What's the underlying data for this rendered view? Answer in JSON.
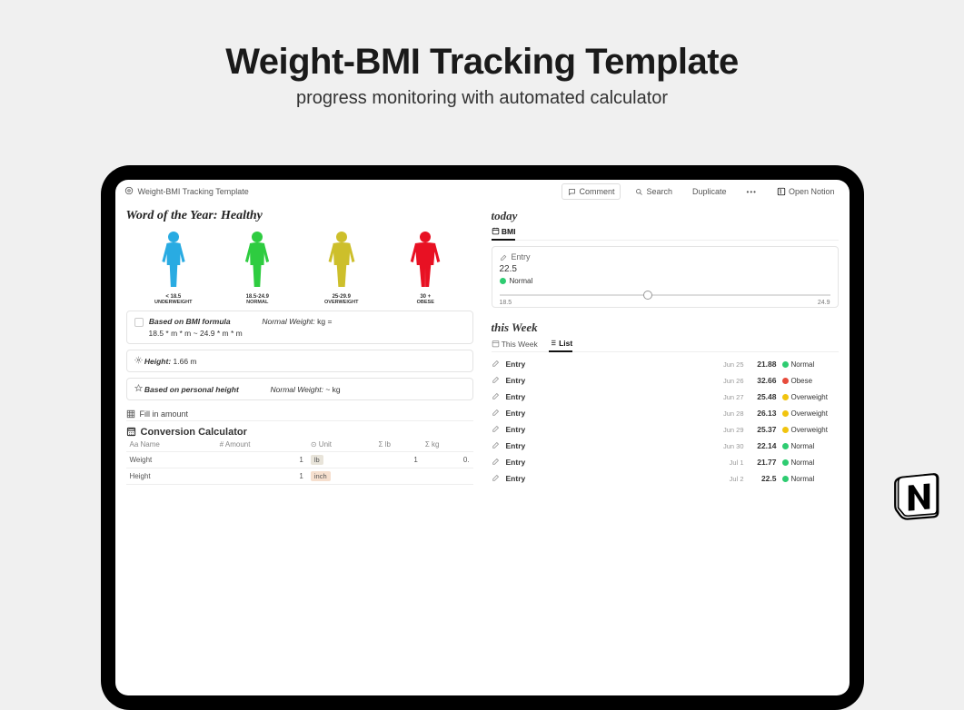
{
  "hero": {
    "title": "Weight-BMI Tracking Template",
    "subtitle": "progress monitoring with automated calculator"
  },
  "topbar": {
    "page_title": "Weight-BMI Tracking Template",
    "comment": "Comment",
    "search": "Search",
    "duplicate": "Duplicate",
    "open": "Open Notion"
  },
  "left": {
    "word": "Word of the Year: Healthy",
    "figures": [
      {
        "range": "< 18.5",
        "label": "UNDERWEIGHT",
        "color": "#29abe2",
        "scale": 0.85
      },
      {
        "range": "18.5-24.9",
        "label": "NORMAL",
        "color": "#2ecc40",
        "scale": 0.9
      },
      {
        "range": "25-29.9",
        "label": "OVERWEIGHT",
        "color": "#cdbf2b",
        "scale": 1.05
      },
      {
        "range": "30 +",
        "label": "OBESE",
        "color": "#e81123",
        "scale": 1.25
      }
    ],
    "formula_label": "Based on BMI formula",
    "normal_weight_label": "Normal Weight:",
    "formula_text": "18.5 * m * m ~ 24.9 * m * m",
    "formula_unit": "kg =",
    "height_label": "Height:",
    "height_value": "1.66 m",
    "personal_label": "Based on personal height",
    "personal_value": "~ kg",
    "fill_label": "Fill in amount",
    "conv_title": "Conversion Calculator",
    "conv_headers": [
      "Aa Name",
      "# Amount",
      "⊙ Unit",
      "Σ lb",
      "Σ kg"
    ],
    "conv_rows": [
      {
        "name": "Weight",
        "amount": "1",
        "unit": "lb",
        "lb": "1",
        "kg": "0."
      },
      {
        "name": "Height",
        "amount": "1",
        "unit": "inch",
        "lb": "",
        "kg": ""
      }
    ]
  },
  "right": {
    "today_title": "today",
    "bmi_tab": "BMI",
    "entry_label": "Entry",
    "bmi_value": "22.5",
    "bmi_status": "Normal",
    "slider_min": "18.5",
    "slider_max": "24.9",
    "slider_pos": 0.45,
    "week_title": "this Week",
    "week_tab1": "This Week",
    "week_tab2": "List",
    "entries": [
      {
        "date": "Jun 25",
        "value": "21.88",
        "status": "Normal",
        "color": "green"
      },
      {
        "date": "Jun 26",
        "value": "32.66",
        "status": "Obese",
        "color": "red"
      },
      {
        "date": "Jun 27",
        "value": "25.48",
        "status": "Overweight",
        "color": "yellow"
      },
      {
        "date": "Jun 28",
        "value": "26.13",
        "status": "Overweight",
        "color": "yellow"
      },
      {
        "date": "Jun 29",
        "value": "25.37",
        "status": "Overweight",
        "color": "yellow"
      },
      {
        "date": "Jun 30",
        "value": "22.14",
        "status": "Normal",
        "color": "green"
      },
      {
        "date": "Jul 1",
        "value": "21.77",
        "status": "Normal",
        "color": "green"
      },
      {
        "date": "Jul 2",
        "value": "22.5",
        "status": "Normal",
        "color": "green"
      }
    ]
  }
}
